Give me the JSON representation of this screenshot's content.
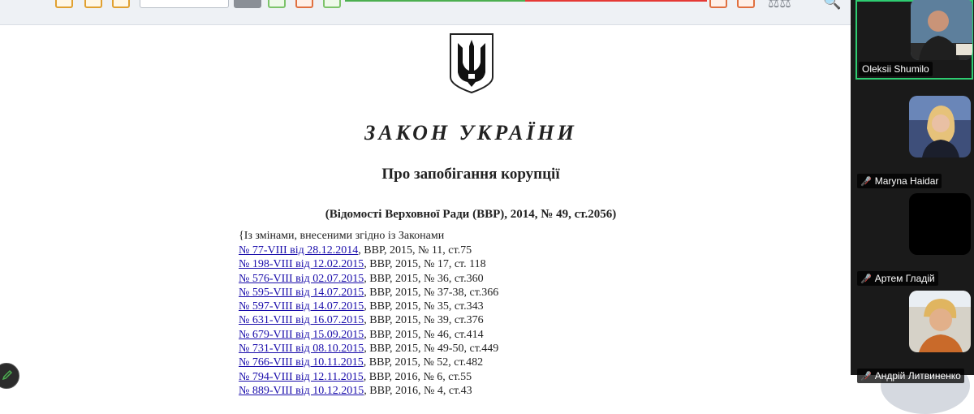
{
  "document": {
    "title": "ЗАКОН УКРАЇНИ",
    "subtitle": "Про запобігання корупції",
    "source": "(Відомості Верховної Ради (ВВР), 2014, № 49, ст.2056)",
    "amendments_intro": "{Із змінами, внесеними згідно із Законами",
    "amendments": [
      {
        "link": "№ 77-VIII від 28.12.2014",
        "ref": ", ВВР, 2015, № 11, ст.75"
      },
      {
        "link": "№ 198-VIII від 12.02.2015",
        "ref": ", ВВР, 2015, № 17, ст. 118"
      },
      {
        "link": "№ 576-VIII від 02.07.2015",
        "ref": ", ВВР, 2015, № 36, ст.360"
      },
      {
        "link": "№ 595-VIII від 14.07.2015",
        "ref": ", ВВР, 2015, № 37-38, ст.366"
      },
      {
        "link": "№ 597-VIII від 14.07.2015",
        "ref": ", ВВР, 2015, № 35, ст.343"
      },
      {
        "link": "№ 631-VIII від 16.07.2015",
        "ref": ", ВВР, 2015, № 39, ст.376"
      },
      {
        "link": "№ 679-VIII від 15.09.2015",
        "ref": ", ВВР, 2015, № 46, ст.414"
      },
      {
        "link": "№ 731-VIII від 08.10.2015",
        "ref": ", ВВР, 2015, № 49-50, ст.449"
      },
      {
        "link": "№ 766-VIII від 10.11.2015",
        "ref": ", ВВР, 2015, № 52, ст.482"
      },
      {
        "link": "№ 794-VIII від 12.11.2015",
        "ref": ", ВВР, 2016, № 6, ст.55"
      },
      {
        "link": "№ 889-VIII від 10.12.2015",
        "ref": ", ВВР, 2016, № 4, ст.43"
      }
    ]
  },
  "participants": [
    {
      "name": "Oleksii Shumilo",
      "muted": false,
      "active": true,
      "video": true
    },
    {
      "name": "Maryna Haidar",
      "muted": true,
      "active": false,
      "video": true
    },
    {
      "name": "Артем Гладій",
      "muted": true,
      "active": false,
      "video": false
    },
    {
      "name": "Андрій Литвиненко",
      "muted": true,
      "active": false,
      "video": true
    }
  ],
  "icons": {
    "emblem": "ukraine-trident-icon",
    "edit": "pencil-icon",
    "mic_muted": "mic-off-icon",
    "search": "search-icon",
    "scales": "scales-icon"
  },
  "colors": {
    "link": "#1a0dab",
    "active_speaker": "#2ecc71",
    "muted": "#e53935",
    "panel_bg": "#1a1a1a"
  }
}
